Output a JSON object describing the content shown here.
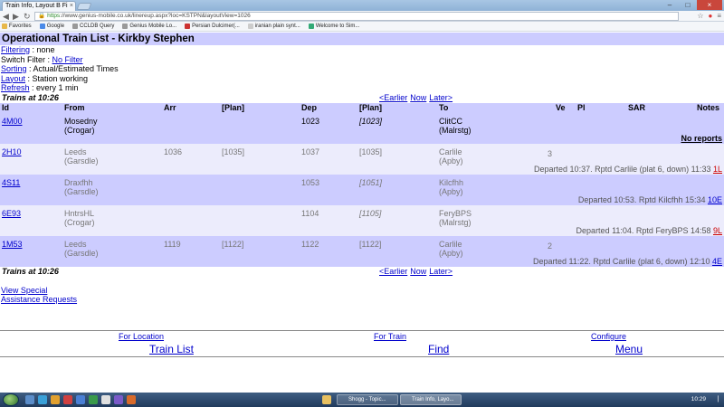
{
  "browser": {
    "tab_title": "Train Info, Layout B Fi",
    "url_scheme": "https",
    "url_rest": "://www.genius-mobile.co.uk/linereup.aspx?loc=KSTPN&layoutView=1026",
    "bookmarks": [
      "Favorites",
      "Google",
      "CCLDB Query",
      "Genius Mobile Lo...",
      "Persian Dulcimer(...",
      "iranian plain synt...",
      "Welcome to Sim..."
    ]
  },
  "page": {
    "title": "Operational Train List - Kirkby Stephen",
    "filtering_label": "Filtering",
    "filtering_value": " : none",
    "switch_filter_text": "Switch Filter : ",
    "switch_filter_link": "No Filter",
    "sorting_label": "Sorting",
    "sorting_value": " : Actual/Estimated Times",
    "layout_label": "Layout",
    "layout_value": " : Station working",
    "refresh_label": "Refresh",
    "refresh_value": " : every 1 min",
    "trains_at": "Trains at 10:26",
    "earlier": "<Earlier",
    "now": "Now",
    "later": "Later>"
  },
  "table": {
    "headers": {
      "id": "Id",
      "from": "From",
      "arr": "Arr",
      "plan_arr": "[Plan]",
      "dep": "Dep",
      "plan_dep": "[Plan]",
      "to": "To",
      "ve": "Ve",
      "pl": "Pl",
      "sar": "SAR",
      "notes": "Notes"
    },
    "rows": [
      {
        "id": "4M00",
        "from": "Mosedny",
        "from_sub": "(Crogar)",
        "arr": "",
        "plan_arr": "",
        "dep": "1023",
        "plan_dep": "[1023]",
        "to": "ClitCC",
        "to_sub": "(Malrstg)",
        "ve": "",
        "note": "",
        "note_code": "No reports"
      },
      {
        "id": "2H10",
        "from": "Leeds",
        "from_sub": "(Garsdle)",
        "arr": "1036",
        "plan_arr": "[1035]",
        "dep": "1037",
        "plan_dep": "[1035]",
        "to": "Carlile",
        "to_sub": "(Apby)",
        "ve": "3",
        "note": "Departed 10:37. Rptd Carlile (plat 6, down) 11:33 ",
        "note_code": "1L"
      },
      {
        "id": "4S11",
        "from": "Draxfhh",
        "from_sub": "(Garsdle)",
        "arr": "",
        "plan_arr": "",
        "dep": "1053",
        "plan_dep": "[1051]",
        "to": "Kilcfhh",
        "to_sub": "(Apby)",
        "ve": "",
        "note": "Departed 10:53. Rptd Kilcfhh 15:34 ",
        "note_code": "10E"
      },
      {
        "id": "6E93",
        "from": "HntrsHL",
        "from_sub": "(Crogar)",
        "arr": "",
        "plan_arr": "",
        "dep": "1104",
        "plan_dep": "[1105]",
        "to": "FeryBPS",
        "to_sub": "(Malrstg)",
        "ve": "",
        "note": "Departed 11:04. Rptd FeryBPS 14:58 ",
        "note_code": "9L"
      },
      {
        "id": "1M53",
        "from": "Leeds",
        "from_sub": "(Garsdle)",
        "arr": "1119",
        "plan_arr": "[1122]",
        "dep": "1122",
        "plan_dep": "[1122]",
        "to": "Carlile",
        "to_sub": "(Apby)",
        "ve": "2",
        "note": "Departed 11:22. Rptd Carlile (plat 6, down) 12:10 ",
        "note_code": "4E"
      }
    ]
  },
  "links": {
    "view_special": "View Special",
    "assistance": "Assistance Requests"
  },
  "bottomnav": {
    "for_location": "For Location",
    "for_train": "For Train",
    "configure": "Configure",
    "train_list": "Train List",
    "find": "Find",
    "menu": "Menu"
  },
  "taskbar": {
    "task1": "Shogg - Topic...",
    "task2": "Train Info, Layo...",
    "clock": "10:29"
  },
  "colors": {
    "header_band": "#ccccff",
    "alt_row": "#ececfc",
    "link": "#0000cc",
    "code_red": "#cc0000",
    "code_blue": "#0000cc"
  }
}
